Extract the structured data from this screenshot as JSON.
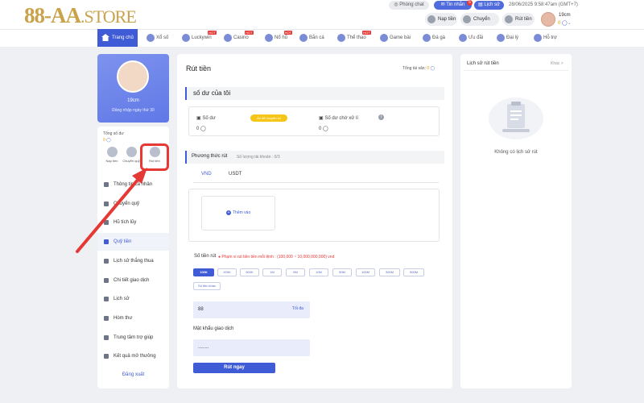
{
  "header": {
    "logo_main": "88-AA",
    "logo_suffix": ".STORE",
    "chat_label": "Phòng chat",
    "mail_label": "Tin nhắn",
    "mail_badge": "5",
    "history_label": "Lịch sử",
    "datetime": "28/06/2025 9:58:47am",
    "timezone": "(GMT+7)",
    "deposit_label": "Nạp tiền",
    "transfer_label": "Chuyển quỹ",
    "withdraw_label": "Rút tiền",
    "username": "19cm",
    "balance": "0",
    "accent": "#3f5bd6"
  },
  "nav": [
    {
      "label": "Trang chủ",
      "icon": "home-icon",
      "active": true
    },
    {
      "label": "Xổ số",
      "icon": "lottery-icon"
    },
    {
      "label": "Luckywin",
      "icon": "luckywin-icon",
      "hot": "HOT"
    },
    {
      "label": "Casino",
      "icon": "casino-icon",
      "hot": "HOT"
    },
    {
      "label": "Nổ hũ",
      "icon": "slot-icon",
      "hot": "HOT"
    },
    {
      "label": "Bắn cá",
      "icon": "fish-icon"
    },
    {
      "label": "Thể thao",
      "icon": "sports-icon",
      "hot": "HOT"
    },
    {
      "label": "Game bài",
      "icon": "cards-icon"
    },
    {
      "label": "Đá gà",
      "icon": "rooster-icon"
    },
    {
      "label": "Ưu đãi",
      "icon": "gift-icon"
    },
    {
      "label": "Đại lý",
      "icon": "agent-icon"
    },
    {
      "label": "Hỗ trợ",
      "icon": "support-icon"
    }
  ],
  "profile": {
    "name": "19cm",
    "login_info": "Đăng nhập ngày thứ 30",
    "total_label": "Tổng số dư",
    "total_value": "0",
    "quick": [
      {
        "label": "Nạp tiền",
        "icon": "deposit-icon"
      },
      {
        "label": "Chuyển quỹ",
        "icon": "transfer-icon"
      },
      {
        "label": "Rút tiền",
        "icon": "withdraw-icon"
      }
    ]
  },
  "sidebar": {
    "items": [
      {
        "label": "Thông tin cá nhân",
        "icon": "user-icon"
      },
      {
        "label": "Chuyển quỹ",
        "icon": "wallet-icon"
      },
      {
        "label": "Hũ tích lũy",
        "icon": "jar-icon"
      },
      {
        "label": "Quỹ tiền",
        "icon": "fund-icon",
        "active": true
      },
      {
        "label": "Lịch sử thắng thua",
        "icon": "win-loss-icon"
      },
      {
        "label": "Chi tiết giao dịch",
        "icon": "transaction-icon"
      },
      {
        "label": "Lịch sử",
        "icon": "history-icon"
      },
      {
        "label": "Hòm thư",
        "icon": "mailbox-icon"
      },
      {
        "label": "Trung tâm trợ giúp",
        "icon": "help-icon"
      },
      {
        "label": "Kết quả mở thưởng",
        "icon": "result-icon"
      }
    ],
    "logout": "Đăng xuất"
  },
  "main": {
    "title": "Rút tiền",
    "total_assets_label": "Tổng tài sản:",
    "total_assets_value": "0",
    "balance_section": "số dư của tôi",
    "balance_label": "Số dư",
    "balance_value": "0",
    "transfer_badge": "Ấn để chuyển số",
    "pending_label": "Số dư chờ xử lí",
    "pending_value": "0",
    "method_section": "Phương thức rút",
    "account_count": "Số lượng tài khoản : 0/3",
    "tabs": [
      "VND",
      "USDT"
    ],
    "add_label": "Thêm vào",
    "amount_label": "Số tiền rút",
    "amount_hint": "Phạm vi rút tiền tiền mỗi lệnh : (100,000 ~ 10,000,000,000) vnd",
    "chips": [
      "100K",
      "200K",
      "500K",
      "1M",
      "5M",
      "10M",
      "50M",
      "100M",
      "300M",
      "500M"
    ],
    "other_amount": "Số tiền khác",
    "amount_value": "88",
    "max_label": "Tối đa",
    "password_label": "Mật khẩu giao dịch",
    "password_value": "........",
    "submit_label": "Rút ngay"
  },
  "right": {
    "title": "Lịch sử rút tiền",
    "more": "Khác >",
    "empty_text": "Không có lịch sử rút"
  }
}
